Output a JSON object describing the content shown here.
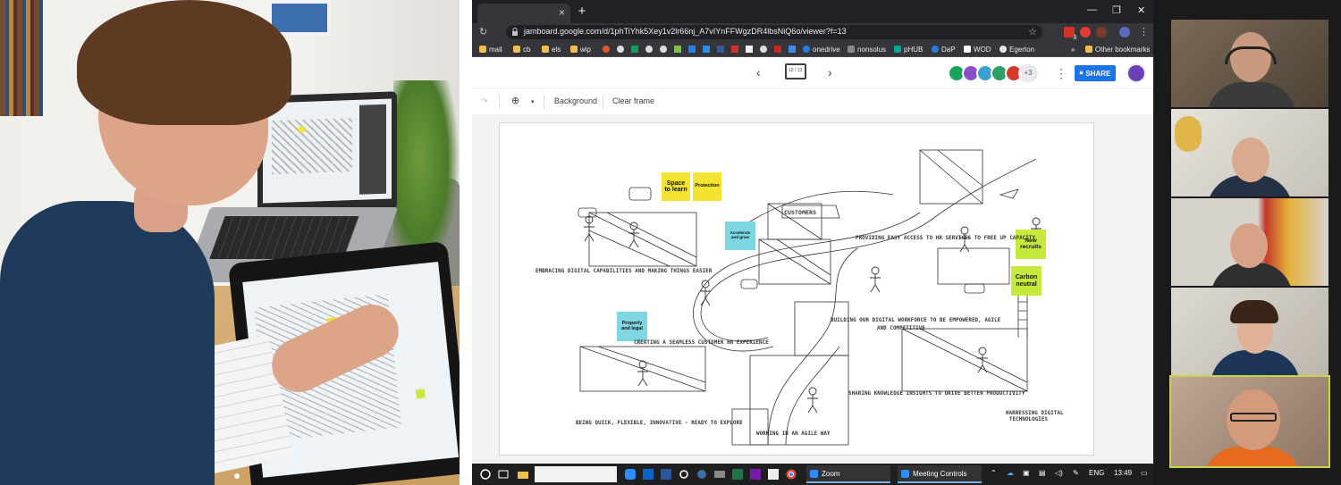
{
  "browser": {
    "tab_close": "×",
    "newtab": "+",
    "window": {
      "min": "—",
      "max": "❐",
      "close": "✕"
    },
    "address_url": "jamboard.google.com/d/1phTiYhk5Xey1v2lr66nj_A7vIYnFFWgzDR4lbsNiQ6o/viewer?f=13",
    "ext_badge": "1",
    "bookmarks": [
      "mail",
      "cb",
      "els",
      "wip",
      "onedrive",
      "nonsolus",
      "pHUB",
      "DaP",
      "WOD",
      "Egerton"
    ],
    "bookmarks_more": "»",
    "other_bookmarks": "Other bookmarks"
  },
  "jamboard": {
    "frame_label": "12 / 13",
    "extra_collaborators": "+3",
    "share_label": "SHARE",
    "toolbar": {
      "background": "Background",
      "clear_frame": "Clear frame"
    }
  },
  "board": {
    "stickies": [
      {
        "text": "Space to learn",
        "color": "#f4e331"
      },
      {
        "text": "Protection",
        "color": "#f4e331"
      },
      {
        "text": "Accelerate and grow",
        "color": "#7fd6e3"
      },
      {
        "text": "New recruits",
        "color": "#c5ea3c"
      },
      {
        "text": "Carbon neutral",
        "color": "#c5ea3c"
      },
      {
        "text": "Property and legal",
        "color": "#7fd6e3"
      }
    ],
    "headings": [
      "EMBRACING DIGITAL CAPABILITIES AND MAKING THINGS EASIER",
      "PROVIDING EASY ACCESS TO HR SERVICES TO FREE UP CAPACITY",
      "BUILDING OUR DIGITAL WORKFORCE TO BE EMPOWERED, AGILE",
      "AND COMPETITIVE",
      "CREATING A SEAMLESS CUSTOMER HR EXPERIENCE",
      "SHARING KNOWLEDGE INSIGHTS TO DRIVE BETTER PRODUCTIVITY",
      "BEING QUICK, FLEXIBLE, INNOVATIVE - READY TO EXPLORE",
      "WORKING IN AN AGILE WAY",
      "HARNESSING DIGITAL",
      "TECHNOLOGIES",
      "CUSTOMERS"
    ]
  },
  "taskbar": {
    "apps": [
      "Zoom",
      "Meeting Controls"
    ],
    "language": "ENG",
    "clock": "13:49"
  }
}
